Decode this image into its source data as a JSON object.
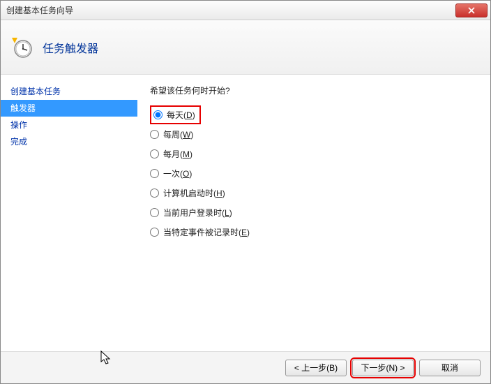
{
  "window": {
    "title": "创建基本任务向导"
  },
  "header": {
    "title": "任务触发器"
  },
  "sidebar": {
    "items": [
      {
        "label": "创建基本任务",
        "active": false
      },
      {
        "label": "触发器",
        "active": true
      },
      {
        "label": "操作",
        "active": false
      },
      {
        "label": "完成",
        "active": false
      }
    ]
  },
  "content": {
    "prompt": "希望该任务何时开始?",
    "options": [
      {
        "label": "每天",
        "accel": "D",
        "checked": true,
        "highlight": true
      },
      {
        "label": "每周",
        "accel": "W",
        "checked": false,
        "highlight": false
      },
      {
        "label": "每月",
        "accel": "M",
        "checked": false,
        "highlight": false
      },
      {
        "label": "一次",
        "accel": "O",
        "checked": false,
        "highlight": false
      },
      {
        "label": "计算机启动时",
        "accel": "H",
        "checked": false,
        "highlight": false
      },
      {
        "label": "当前用户登录时",
        "accel": "L",
        "checked": false,
        "highlight": false
      },
      {
        "label": "当特定事件被记录时",
        "accel": "E",
        "checked": false,
        "highlight": false
      }
    ]
  },
  "footer": {
    "back": "< 上一步(B)",
    "next": "下一步(N) >",
    "cancel": "取消"
  }
}
